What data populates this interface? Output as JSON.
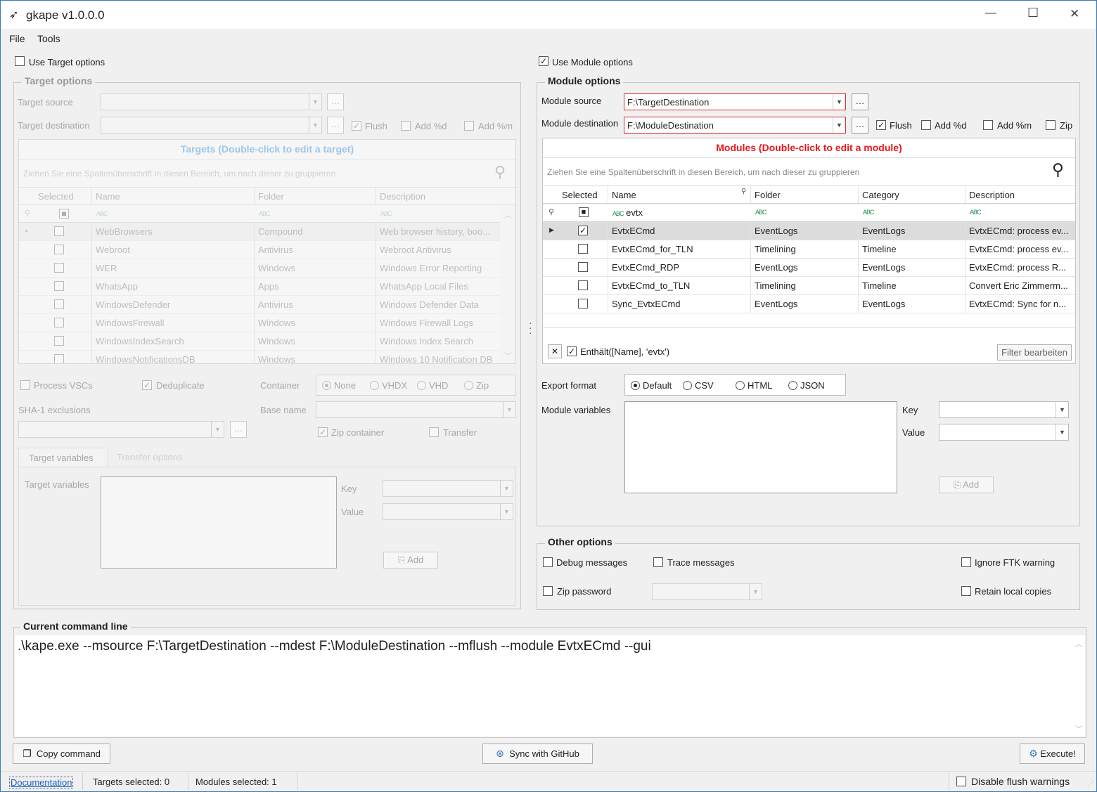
{
  "window": {
    "title": "gkape v1.0.0.0",
    "min": "—",
    "max": "☐",
    "close": "✕",
    "app_icon": "kape-bird-icon"
  },
  "menu": {
    "file": "File",
    "tools": "Tools"
  },
  "target": {
    "use_label": "Use Target options",
    "group_title": "Target options",
    "source_label": "Target source",
    "dest_label": "Target destination",
    "flush": "Flush",
    "add_d": "Add %d",
    "add_m": "Add %m",
    "grid_caption": "Targets (Double-click to edit a target)",
    "group_panel_hint": "Ziehen Sie eine Spaltenüberschrift in diesen Bereich, um nach dieser zu gruppieren",
    "columns": [
      "Selected",
      "Name",
      "Folder",
      "Description"
    ],
    "rows": [
      {
        "name": "WebBrowsers",
        "folder": "Compound",
        "description": "Web browser history, boo..."
      },
      {
        "name": "Webroot",
        "folder": "Antivirus",
        "description": "Webroot Antivirus"
      },
      {
        "name": "WER",
        "folder": "Windows",
        "description": "Windows Error Reporting"
      },
      {
        "name": "WhatsApp",
        "folder": "Apps",
        "description": "WhatsApp Local Files"
      },
      {
        "name": "WindowsDefender",
        "folder": "Antivirus",
        "description": "Windows Defender Data"
      },
      {
        "name": "WindowsFirewall",
        "folder": "Windows",
        "description": "Windows Firewall Logs"
      },
      {
        "name": "WindowsIndexSearch",
        "folder": "Windows",
        "description": "Windows Index Search"
      },
      {
        "name": "WindowsNotificationsDB",
        "folder": "Windows",
        "description": "Windows 10 Notification DB"
      }
    ],
    "process_vsc": "Process VSCs",
    "deduplicate": "Deduplicate",
    "container_label": "Container",
    "container_opts": [
      "None",
      "VHDX",
      "VHD",
      "Zip"
    ],
    "sha_label": "SHA-1 exclusions",
    "base_name_label": "Base name",
    "zip_container": "Zip container",
    "transfer": "Transfer",
    "tabs": [
      "Target variables",
      "Transfer options"
    ],
    "vars_label": "Target variables",
    "key_label": "Key",
    "value_label": "Value",
    "add": "Add"
  },
  "module": {
    "use_label": "Use Module options",
    "group_title": "Module options",
    "source_label": "Module source",
    "source_value": "F:\\TargetDestination",
    "dest_label": "Module destination",
    "dest_value": "F:\\ModuleDestination",
    "flush": "Flush",
    "add_d": "Add %d",
    "add_m": "Add %m",
    "zip": "Zip",
    "grid_caption": "Modules (Double-click to edit a module)",
    "group_panel_hint": "Ziehen Sie eine Spaltenüberschrift in diesen Bereich, um nach dieser zu gruppieren",
    "columns": [
      "Selected",
      "Name",
      "Folder",
      "Category",
      "Description"
    ],
    "filter_name": "evtx",
    "rows": [
      {
        "name": "EvtxECmd",
        "folder": "EventLogs",
        "category": "EventLogs",
        "description": "EvtxECmd: process ev...",
        "selected": true
      },
      {
        "name": "EvtxECmd_for_TLN",
        "folder": "Timelining",
        "category": "Timeline",
        "description": "EvtxECmd: process ev...",
        "selected": false
      },
      {
        "name": "EvtxECmd_RDP",
        "folder": "EventLogs",
        "category": "EventLogs",
        "description": "EvtxECmd: process R...",
        "selected": false
      },
      {
        "name": "EvtxECmd_to_TLN",
        "folder": "Timelining",
        "category": "Timeline",
        "description": "Convert Eric Zimmerm...",
        "selected": false
      },
      {
        "name": "Sync_EvtxECmd",
        "folder": "EventLogs",
        "category": "EventLogs",
        "description": "EvtxECmd: Sync for n...",
        "selected": false
      }
    ],
    "filter_expr": "Enthält([Name], 'evtx')",
    "filter_edit": "Filter bearbeiten",
    "export_label": "Export format",
    "export_opts": [
      "Default",
      "CSV",
      "HTML",
      "JSON"
    ],
    "vars_label": "Module variables",
    "key_label": "Key",
    "value_label": "Value",
    "add": "Add"
  },
  "other": {
    "title": "Other options",
    "debug": "Debug messages",
    "trace": "Trace messages",
    "ignore_ftk": "Ignore FTK warning",
    "zip_password": "Zip password",
    "retain": "Retain local copies"
  },
  "cmd": {
    "title": "Current command line",
    "text": ".\\kape.exe --msource F:\\TargetDestination --mdest F:\\ModuleDestination --mflush --module EvtxECmd --gui"
  },
  "buttons": {
    "copy": "Copy command",
    "sync": "Sync with GitHub",
    "execute": "Execute!"
  },
  "status": {
    "doc": "Documentation",
    "targets": "Targets selected: 0",
    "modules": "Modules selected: 1",
    "disable_flush": "Disable flush warnings"
  }
}
